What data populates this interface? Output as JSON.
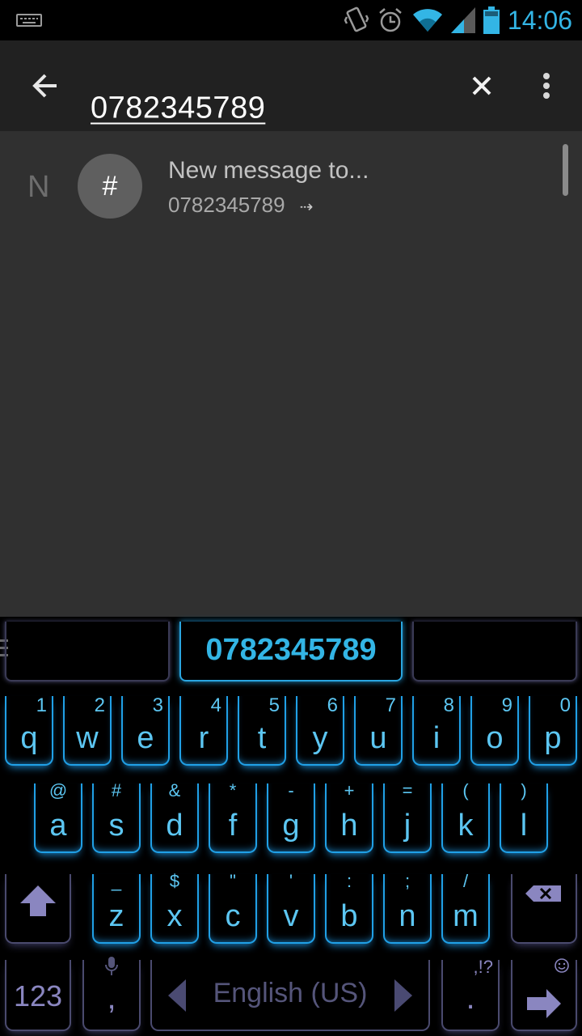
{
  "status_bar": {
    "time": "14:06",
    "icons": [
      "keyboard-icon",
      "vibrate-icon",
      "alarm-icon",
      "wifi-icon",
      "signal-icon",
      "battery-icon"
    ],
    "accent_color": "#33b5e5"
  },
  "app_bar": {
    "search_value": "0782345789",
    "icons": [
      "back-arrow-icon",
      "close-icon",
      "overflow-menu-icon"
    ]
  },
  "results": {
    "section_letter": "N",
    "avatar_glyph": "#",
    "title": "New message to...",
    "number": "0782345789",
    "arrow": "⇢"
  },
  "keyboard": {
    "suggestion": "0782345789",
    "rows": [
      [
        {
          "k": "q",
          "h": "1"
        },
        {
          "k": "w",
          "h": "2"
        },
        {
          "k": "e",
          "h": "3"
        },
        {
          "k": "r",
          "h": "4"
        },
        {
          "k": "t",
          "h": "5"
        },
        {
          "k": "y",
          "h": "6"
        },
        {
          "k": "u",
          "h": "7"
        },
        {
          "k": "i",
          "h": "8"
        },
        {
          "k": "o",
          "h": "9"
        },
        {
          "k": "p",
          "h": "0"
        }
      ],
      [
        {
          "k": "a",
          "h": "@"
        },
        {
          "k": "s",
          "h": "#"
        },
        {
          "k": "d",
          "h": "&"
        },
        {
          "k": "f",
          "h": "*"
        },
        {
          "k": "g",
          "h": "-"
        },
        {
          "k": "h",
          "h": "+"
        },
        {
          "k": "j",
          "h": "="
        },
        {
          "k": "k",
          "h": "("
        },
        {
          "k": "l",
          "h": ")"
        }
      ],
      [
        {
          "k": "z",
          "h": "_"
        },
        {
          "k": "x",
          "h": "$"
        },
        {
          "k": "c",
          "h": "\""
        },
        {
          "k": "v",
          "h": "'"
        },
        {
          "k": "b",
          "h": ":"
        },
        {
          "k": "n",
          "h": ";"
        },
        {
          "k": "m",
          "h": "/"
        }
      ]
    ],
    "numbers_key": "123",
    "comma_key": ",",
    "language": "English (US)",
    "period_key": ".",
    "period_hint": ",!?",
    "accent_color": "#20a0e6",
    "muted_color": "#4a4a6e"
  }
}
